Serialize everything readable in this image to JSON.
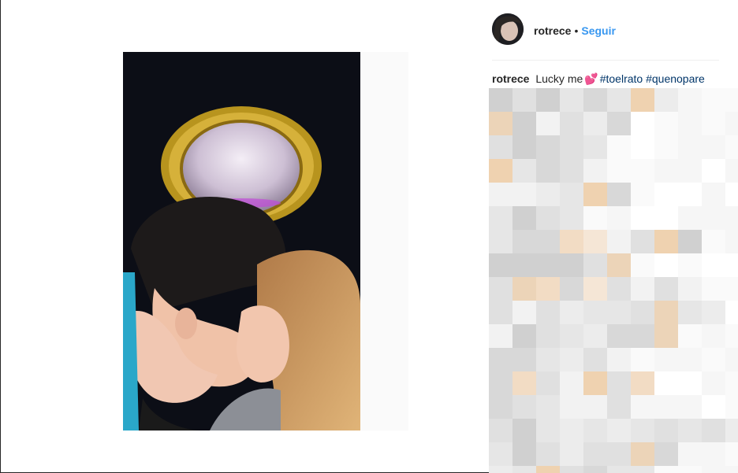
{
  "post": {
    "author": "rotrece",
    "separator": "•",
    "follow_label": "Seguir",
    "caption": {
      "author": "rotrece",
      "text": "Lucky me",
      "emoji": "💕",
      "hashtags": [
        "#toelrato",
        "#quenopare"
      ]
    }
  },
  "icons": {
    "avatar": "profile-avatar",
    "photo": "post-photo"
  },
  "colors": {
    "link_blue": "#3897f0",
    "hashtag": "#003569",
    "text": "#262626",
    "divider": "#efefef"
  }
}
